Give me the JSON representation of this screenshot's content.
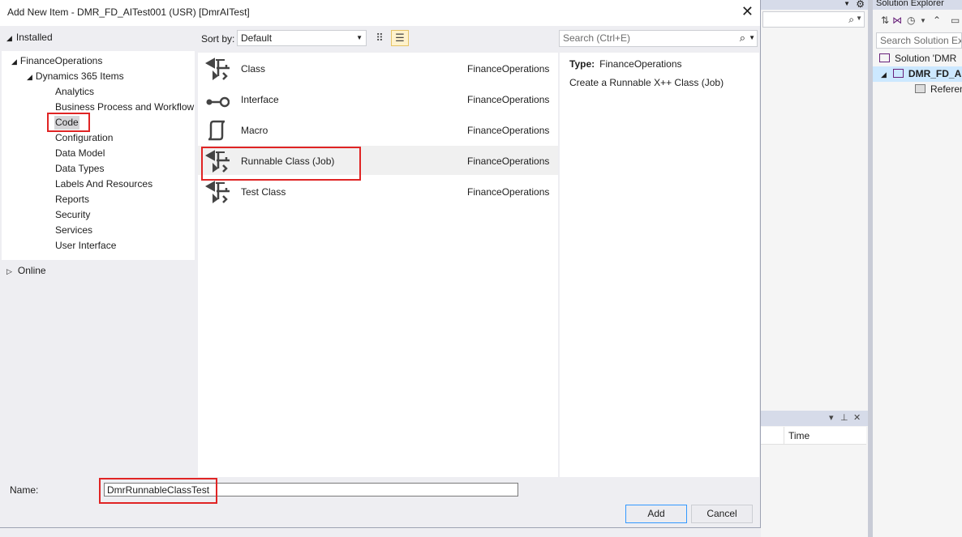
{
  "dialog": {
    "title": "Add New Item - DMR_FD_AITest001 (USR) [DmrAITest]",
    "close_glyph": "✕"
  },
  "left": {
    "installed": "Installed",
    "tree": {
      "root": "FinanceOperations",
      "child": "Dynamics 365 Items",
      "items": [
        "Analytics",
        "Business Process and Workflow",
        "Code",
        "Configuration",
        "Data Model",
        "Data Types",
        "Labels And Resources",
        "Reports",
        "Security",
        "Services",
        "User Interface"
      ]
    },
    "online": "Online"
  },
  "sort": {
    "label": "Sort by:",
    "value": "Default"
  },
  "search": {
    "placeholder": "Search (Ctrl+E)"
  },
  "items": [
    {
      "name": "Class",
      "category": "FinanceOperations",
      "icon": "class-icon"
    },
    {
      "name": "Interface",
      "category": "FinanceOperations",
      "icon": "interface-icon"
    },
    {
      "name": "Macro",
      "category": "FinanceOperations",
      "icon": "macro-icon"
    },
    {
      "name": "Runnable Class (Job)",
      "category": "FinanceOperations",
      "icon": "class-icon"
    },
    {
      "name": "Test Class",
      "category": "FinanceOperations",
      "icon": "class-icon"
    }
  ],
  "details": {
    "type_label": "Type:",
    "type_value": "FinanceOperations",
    "description": "Create a Runnable X++ Class (Job)"
  },
  "name_field": {
    "label": "Name:",
    "value": "DmrRunnableClassTest"
  },
  "buttons": {
    "add": "Add",
    "cancel": "Cancel"
  },
  "background": {
    "panel_column": "Time",
    "solution_explorer": {
      "title": "Solution Explorer",
      "search_placeholder": "Search Solution Exp",
      "rows": [
        "Solution 'DMR",
        "DMR_FD_A",
        "Referen"
      ]
    }
  },
  "colors": {
    "highlight": "#e02424",
    "selection": "#cce8ff",
    "primary_border": "#3399ff"
  }
}
